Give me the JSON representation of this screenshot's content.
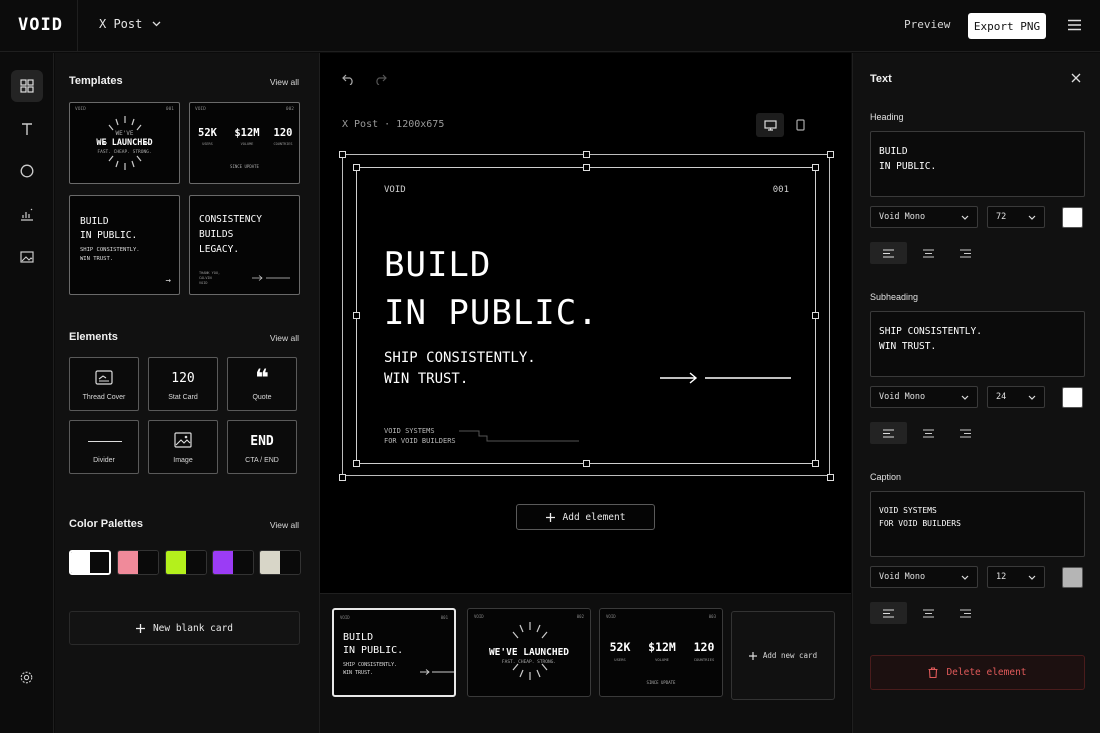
{
  "app": {
    "logo": "VOID",
    "format": "X Post"
  },
  "topbar": {
    "preview_label": "Preview",
    "export_label": "Export PNG"
  },
  "rail": {
    "icons": [
      "grid-icon",
      "text-icon",
      "circle-icon",
      "chart-icon",
      "image-icon",
      "settings-icon"
    ]
  },
  "templates": {
    "title": "Templates",
    "view_all": "View all",
    "items": [
      {
        "brand": "VOID",
        "num": "001",
        "line1": "WE'VE",
        "main": "WE LAUNCHED",
        "sub": "FAST. CHEAP. STRONG."
      },
      {
        "brand": "VOID",
        "num": "002",
        "stats": [
          [
            "52K",
            "USERS"
          ],
          [
            "$12M",
            "VOLUME"
          ],
          [
            "120",
            "COUNTRIES"
          ]
        ],
        "footer": "SINCE UPDATE"
      },
      {
        "text": "BUILD\nIN PUBLIC.",
        "sub": "SHIP CONSISTENTLY.\nWIN TRUST.",
        "arrow": "→"
      },
      {
        "text": "CONSISTENCY\nBUILDS\nLEGACY.",
        "sub": "THANK YOU,\nCALVIN\nVOID"
      }
    ]
  },
  "elements": {
    "title": "Elements",
    "view_all": "View all",
    "items": [
      {
        "label": "Thread Cover",
        "graphic": ""
      },
      {
        "label": "Stat Card",
        "graphic": "120"
      },
      {
        "label": "Quote",
        "graphic": "❝"
      },
      {
        "label": "Divider",
        "graphic": ""
      },
      {
        "label": "Image",
        "graphic": ""
      },
      {
        "label": "CTA / END",
        "graphic": "END"
      }
    ]
  },
  "palettes": {
    "title": "Color Palettes",
    "view_all": "View all",
    "items": [
      {
        "a": "#ffffff",
        "b": "#0a0a0a"
      },
      {
        "a": "#f08a9a",
        "b": "#0a0a0a"
      },
      {
        "a": "#b4f01c",
        "b": "#0a0a0a"
      },
      {
        "a": "#9b3cf5",
        "b": "#0a0a0a"
      },
      {
        "a": "#d8d6c8",
        "b": "#0a0a0a"
      }
    ]
  },
  "new_blank_label": "New blank card",
  "canvas": {
    "label": "X Post · 1200x675",
    "card": {
      "brand": "VOID",
      "num": "001",
      "heading": "BUILD\nIN PUBLIC.",
      "subheading": "SHIP CONSISTENTLY.\nWIN TRUST.",
      "caption": "VOID SYSTEMS\nFOR VOID BUILDERS"
    },
    "add_element_label": "Add element"
  },
  "filmstrip": {
    "cards": [
      {
        "heading": "BUILD\nIN PUBLIC.",
        "sub": "SHIP CONSISTENTLY.\nWIN TRUST.",
        "brand": "VOID",
        "num": "001"
      },
      {
        "main": "WE'VE LAUNCHED",
        "sub": "FAST. CHEAP. STRONG.",
        "brand": "VOID",
        "num": "002"
      },
      {
        "stats": [
          [
            "52K",
            "USERS"
          ],
          [
            "$12M",
            "VOLUME"
          ],
          [
            "120",
            "COUNTRIES"
          ]
        ],
        "footer": "SINCE UPDATE",
        "brand": "VOID",
        "num": "003"
      }
    ],
    "add_card_label": "Add new card"
  },
  "inspector": {
    "title": "Text",
    "heading": {
      "label": "Heading",
      "value": "BUILD\nIN PUBLIC.",
      "font": "Void Mono",
      "size": "72",
      "color": "#ffffff"
    },
    "subheading": {
      "label": "Subheading",
      "value": "SHIP CONSISTENTLY.\nWIN TRUST.",
      "font": "Void Mono",
      "size": "24",
      "color": "#ffffff"
    },
    "caption": {
      "label": "Caption",
      "value": "VOID SYSTEMS\nFOR VOID BUILDERS",
      "font": "Void Mono",
      "size": "12",
      "color": "#b5b5b5"
    },
    "delete_label": "Delete element"
  }
}
